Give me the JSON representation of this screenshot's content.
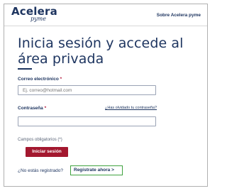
{
  "header": {
    "logo_main": "Acelera",
    "logo_sub": "pyme",
    "link": "Sobre Acelera pyme"
  },
  "form": {
    "title": "Inicia sesión y accede al área privada",
    "email_label": "Correo electrónico",
    "email_required": "*",
    "email_placeholder": "Ej. correo@hotmail.com",
    "email_value": "",
    "password_label": "Contraseña",
    "password_required": "*",
    "password_placeholder": "",
    "password_value": "",
    "forgot_link": "¿Has olvidado tu contraseña?",
    "required_note": "Campos obligatorios (*)",
    "login_button": "Iniciar sesión",
    "no_register_text": "¿No estás registrado?",
    "register_link": "Regístrate ahora >"
  },
  "colors": {
    "brand_navy": "#1e3560",
    "button_red": "#a3182f",
    "focus_green": "#3fa23f"
  }
}
